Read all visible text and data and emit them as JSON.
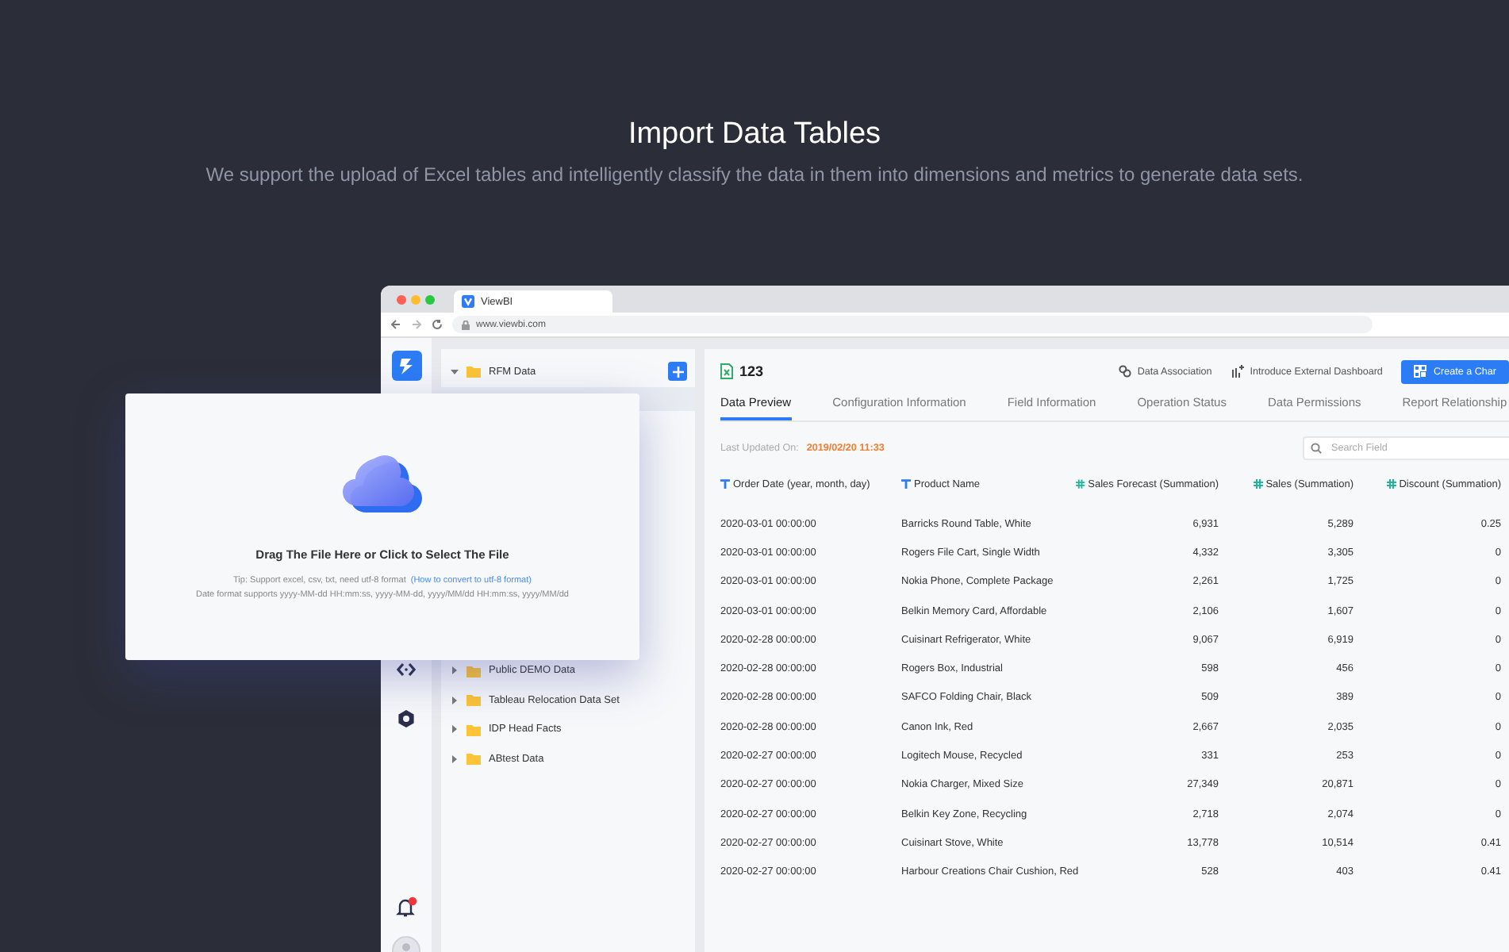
{
  "hero": {
    "title": "Import Data Tables",
    "subtitle": "We support the upload of Excel tables and intelligently classify the data in them into dimensions and metrics to generate data sets."
  },
  "browser": {
    "tab_title": "ViewBI",
    "url": "www.viewbi.com"
  },
  "tree": {
    "items": [
      {
        "label": "RFM Data",
        "expanded": true
      },
      {
        "label": "Public DEMO Data",
        "expanded": false
      },
      {
        "label": "Tableau Relocation Data Set",
        "expanded": false
      },
      {
        "label": "IDP Head Facts",
        "expanded": false
      },
      {
        "label": "ABtest Data",
        "expanded": false
      }
    ]
  },
  "dataset": {
    "name": "123",
    "actions": [
      {
        "label": "Data Association",
        "kind": "association"
      },
      {
        "label": "Introduce External Dashboard",
        "kind": "external"
      },
      {
        "label": "Create a Char",
        "kind": "create"
      }
    ],
    "tabs": [
      {
        "label": "Data Preview",
        "selected": true
      },
      {
        "label": "Configuration Information",
        "selected": false
      },
      {
        "label": "Field Information",
        "selected": false
      },
      {
        "label": "Operation Status",
        "selected": false
      },
      {
        "label": "Data Permissions",
        "selected": false
      },
      {
        "label": "Report Relationship",
        "selected": false
      }
    ],
    "last_updated_label": "Last Updated On:",
    "last_updated": "2019/02/20  11:33",
    "search": {
      "placeholder": "Search Field"
    },
    "table": {
      "columns": [
        {
          "label": "Order Date (year, month, day)",
          "kind": "dimension"
        },
        {
          "label": "Product Name",
          "kind": "dimension"
        },
        {
          "label": "Sales Forecast (Summation)",
          "kind": "measure"
        },
        {
          "label": "Sales (Summation)",
          "kind": "measure"
        },
        {
          "label": "Discount (Summation)",
          "kind": "measure"
        }
      ],
      "rows": [
        [
          "2020-03-01  00:00:00",
          "Barricks Round Table, White",
          "6,931",
          "5,289",
          "0.25"
        ],
        [
          "2020-03-01  00:00:00",
          "Rogers File Cart, Single Width",
          "4,332",
          "3,305",
          "0"
        ],
        [
          "2020-03-01  00:00:00",
          "Nokia Phone, Complete Package",
          "2,261",
          "1,725",
          "0"
        ],
        [
          "2020-03-01  00:00:00",
          "Belkin Memory Card, Affordable",
          "2,106",
          "1,607",
          "0"
        ],
        [
          "2020-02-28  00:00:00",
          "Cuisinart Refrigerator, White",
          "9,067",
          "6,919",
          "0"
        ],
        [
          "2020-02-28  00:00:00",
          "Rogers Box, Industrial",
          "598",
          "456",
          "0"
        ],
        [
          "2020-02-28  00:00:00",
          "SAFCO Folding Chair, Black",
          "509",
          "389",
          "0"
        ],
        [
          "2020-02-28  00:00:00",
          "Canon Ink, Red",
          "2,667",
          "2,035",
          "0"
        ],
        [
          "2020-02-27  00:00:00",
          "Logitech Mouse, Recycled",
          "331",
          "253",
          "0"
        ],
        [
          "2020-02-27  00:00:00",
          "Nokia Charger, Mixed Size",
          "27,349",
          "20,871",
          "0"
        ],
        [
          "2020-02-27  00:00:00",
          "Belkin Key Zone, Recycling",
          "2,718",
          "2,074",
          "0"
        ],
        [
          "2020-02-27  00:00:00",
          "Cuisinart Stove, White",
          "13,778",
          "10,514",
          "0.41"
        ],
        [
          "2020-02-27  00:00:00",
          "Harbour Creations Chair Cushion, Red",
          "528",
          "403",
          "0.41"
        ]
      ]
    }
  },
  "upload_modal": {
    "title": "Drag The File Here or Click to Select The File",
    "tip": "Tip: Support excel, csv, txt, need utf-8 format",
    "tip_link": "(How to convert to utf-8 format)",
    "date_formats": "Date format supports yyyy-MM-dd HH:mm:ss, yyyy-MM-dd, yyyy/MM/dd HH:mm:ss, yyyy/MM/dd"
  }
}
